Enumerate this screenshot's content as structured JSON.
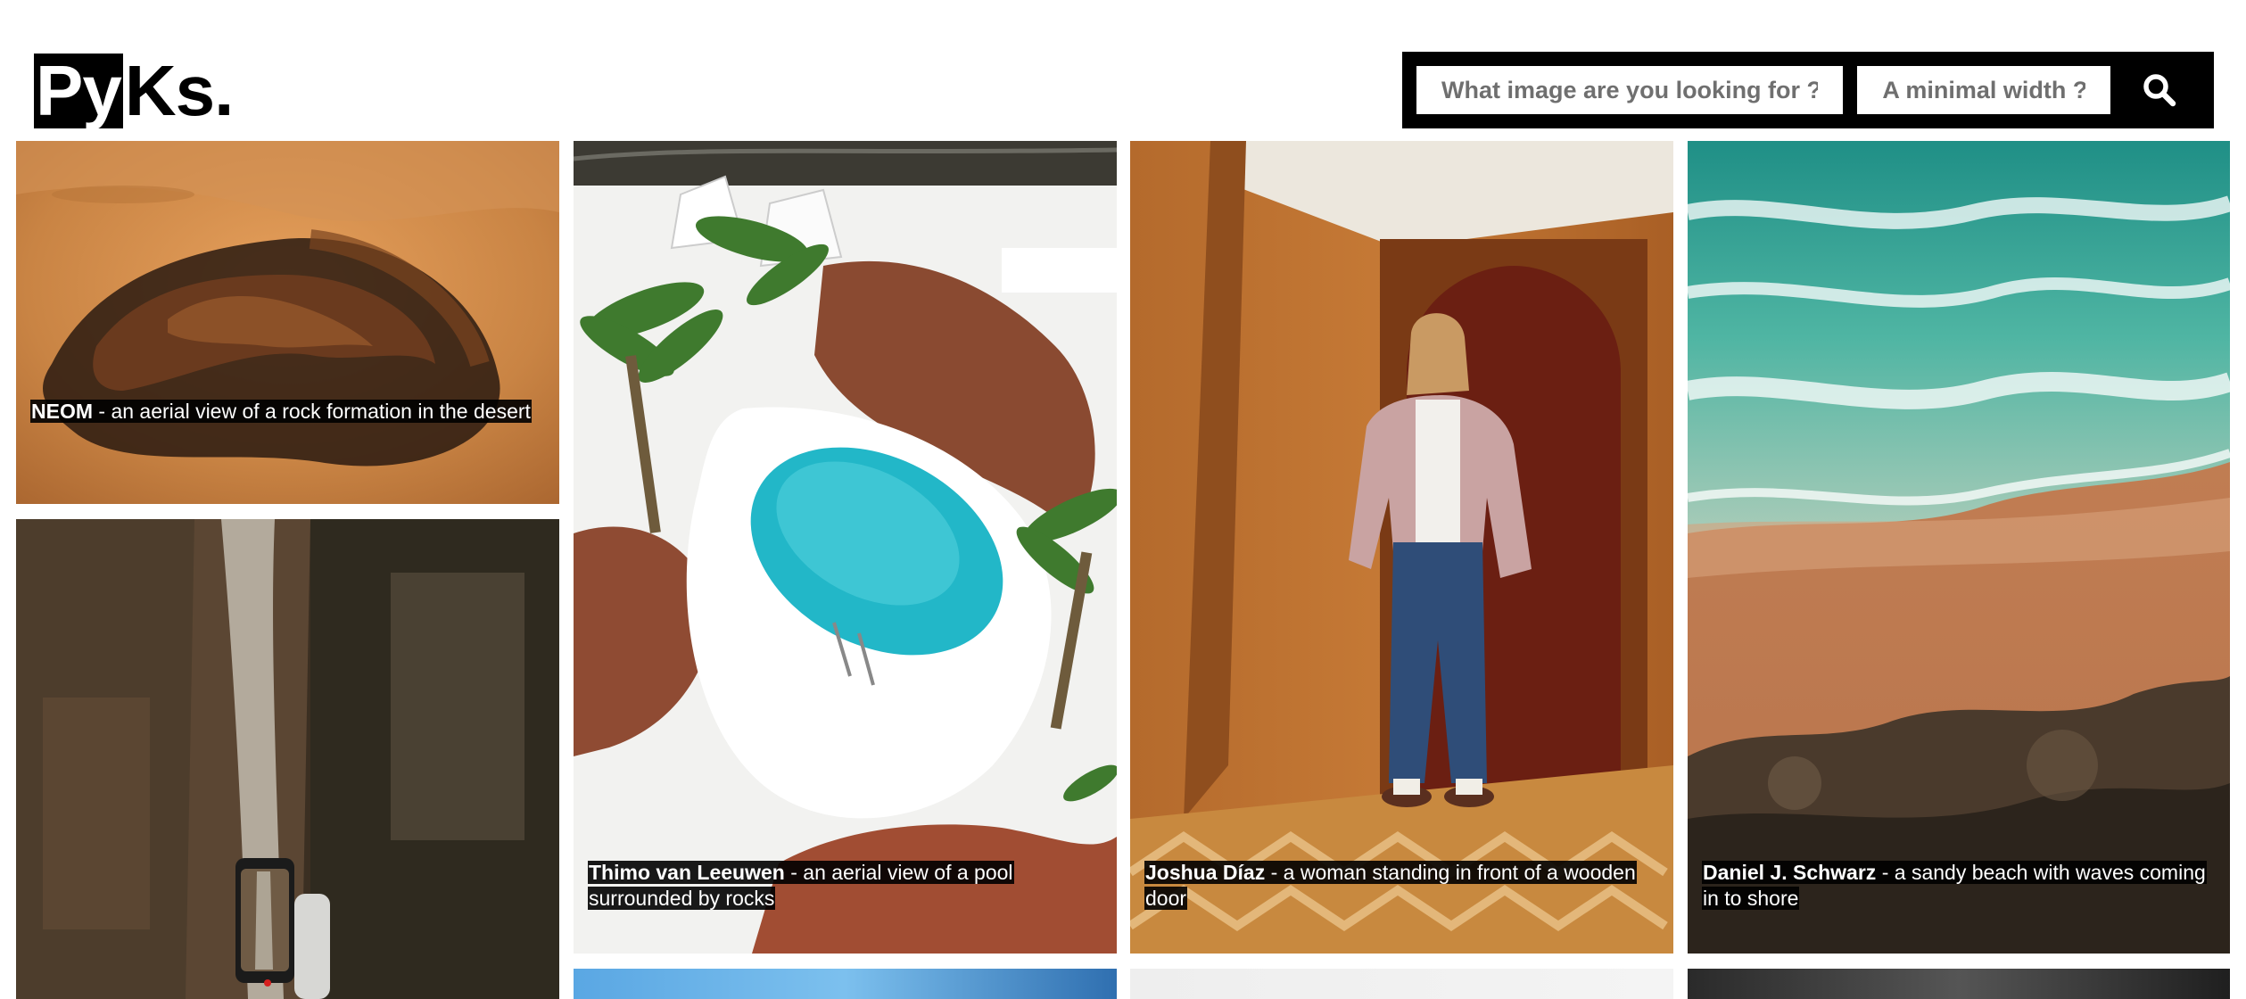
{
  "logo": {
    "highlight": "Py",
    "rest": "Ks."
  },
  "search": {
    "query_placeholder": "What image are you looking for ?",
    "width_placeholder": "A minimal width ?",
    "button_icon": "search-icon"
  },
  "photos": [
    {
      "author": "NEOM",
      "separator": " - ",
      "description": "an aerial view of a rock formation in the desert"
    },
    {
      "author": "",
      "separator": "",
      "description": ""
    },
    {
      "author": "Thimo van Leeuwen",
      "separator": " - ",
      "description": "an aerial view of a pool surrounded by rocks"
    },
    {
      "author": "Joshua Díaz",
      "separator": " - ",
      "description": "a woman standing in front of a wooden door"
    },
    {
      "author": "Daniel J. Schwarz",
      "separator": " - ",
      "description": "a sandy beach with waves coming in to shore"
    }
  ],
  "colors": {
    "accent": "#000000",
    "background": "#ffffff",
    "caption_bg": "#000000",
    "caption_text": "#ffffff"
  }
}
